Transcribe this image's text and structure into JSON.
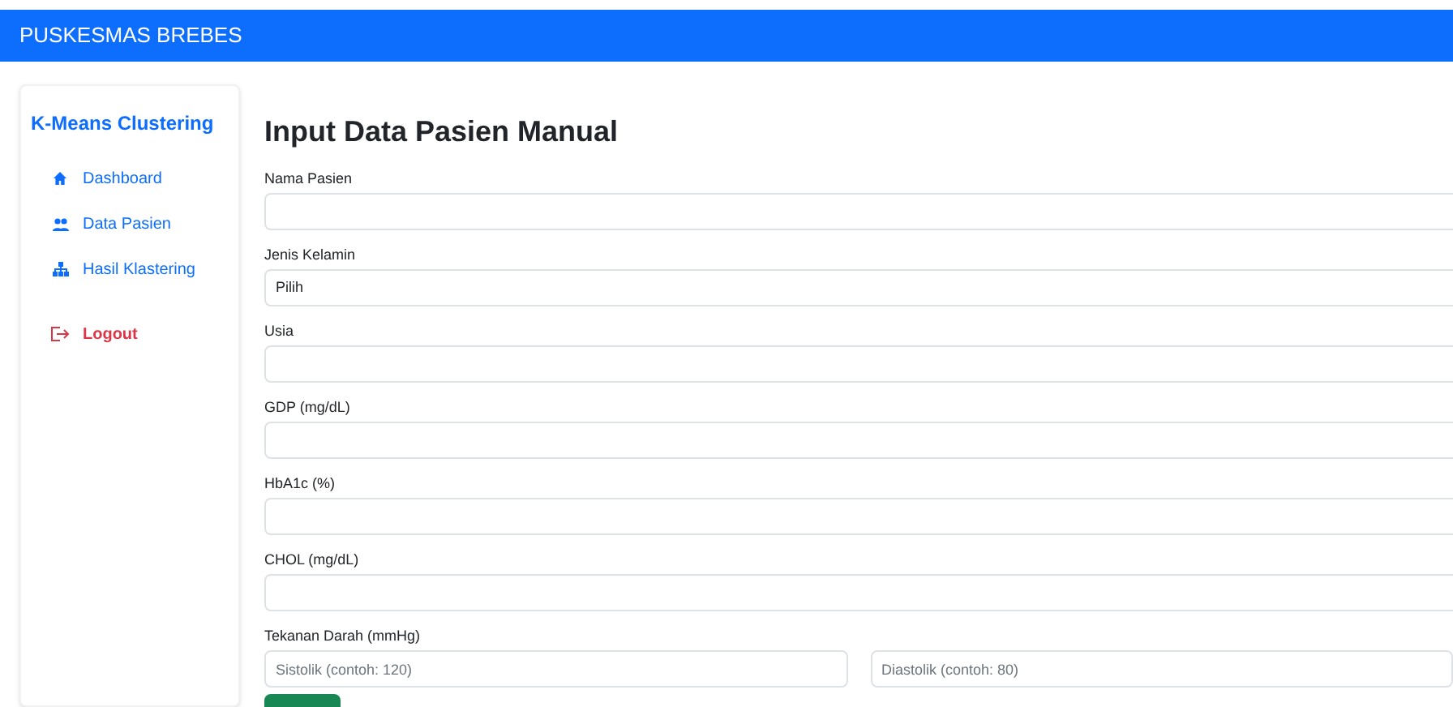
{
  "navbar": {
    "brand": "PUSKESMAS BREBES"
  },
  "sidebar": {
    "title": "K-Means Clustering",
    "items": [
      {
        "label": "Dashboard",
        "kind": "home"
      },
      {
        "label": "Data Pasien",
        "kind": "users"
      },
      {
        "label": "Hasil Klastering",
        "kind": "tree"
      },
      {
        "label": "Logout",
        "kind": "logout"
      }
    ]
  },
  "form": {
    "title": "Input Data Pasien Manual",
    "fields": [
      {
        "label": "Nama Pasien",
        "kind": "input"
      },
      {
        "label": "Jenis Kelamin",
        "kind": "select",
        "value": "Pilih"
      },
      {
        "label": "Usia",
        "kind": "input"
      },
      {
        "label": "GDP (mg/dL)",
        "kind": "input"
      },
      {
        "label": "HbA1c (%)",
        "kind": "input"
      },
      {
        "label": "CHOL (mg/dL)",
        "kind": "input"
      },
      {
        "label": "Tekanan Darah (mmHg)",
        "kind": "pair",
        "placeholders": [
          "Sistolik (contoh: 120)",
          "Diastolik (contoh: 80)"
        ]
      }
    ]
  }
}
